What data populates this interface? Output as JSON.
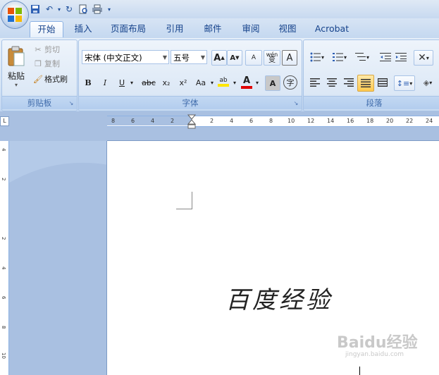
{
  "tabs": [
    "开始",
    "插入",
    "页面布局",
    "引用",
    "邮件",
    "审阅",
    "视图",
    "Acrobat"
  ],
  "active_tab": "开始",
  "clipboard": {
    "paste_label": "粘贴",
    "cut_label": "剪切",
    "copy_label": "复制",
    "format_painter_label": "格式刷",
    "group_label": "剪贴板"
  },
  "font": {
    "font_name": "宋体 (中文正文)",
    "font_size": "五号",
    "group_label": "字体",
    "bold": "B",
    "italic": "I",
    "underline": "U",
    "strikethrough": "abc",
    "subscript": "x₂",
    "superscript": "x²",
    "change_case": "Aa",
    "highlight": "ab",
    "font_color": "A",
    "char_shading": "A",
    "enclose": "字",
    "grow": "A",
    "shrink": "A",
    "clear": "A",
    "phonetic": "wén"
  },
  "paragraph": {
    "group_label": "段落"
  },
  "ruler": {
    "left_numbers": [
      "8",
      "6",
      "4",
      "2"
    ],
    "right_numbers": [
      "2",
      "4",
      "6",
      "8",
      "10",
      "12",
      "14",
      "16",
      "18",
      "20",
      "22",
      "24"
    ],
    "vertical_numbers": [
      "4",
      "2",
      "2",
      "4",
      "6",
      "8",
      "10"
    ],
    "corner": "L"
  },
  "document": {
    "text": "百度经验"
  },
  "watermark": {
    "main": "Baidu经验",
    "sub": "jingyan.baidu.com"
  },
  "colors": {
    "accent": "#15428b",
    "highlight_yellow": "#ffe600",
    "font_red": "#e00000"
  }
}
